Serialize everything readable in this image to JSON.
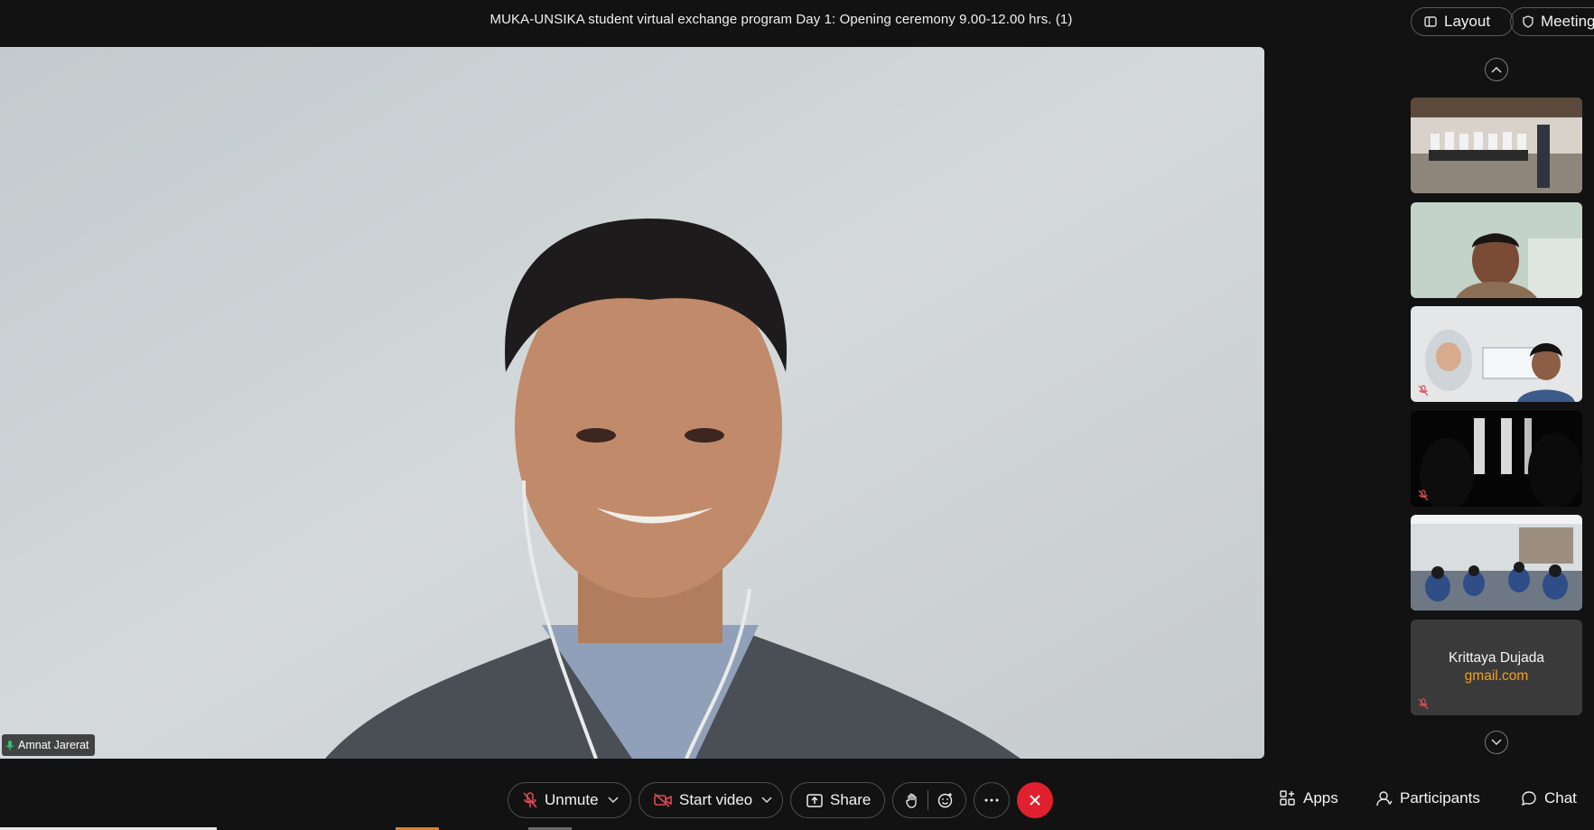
{
  "header": {
    "title": "MUKA-UNSIKA student virtual exchange program Day 1: Opening ceremony 9.00-12.00 hrs. (1)",
    "layout_label": "Layout",
    "meeting_label": "Meeting"
  },
  "main_video": {
    "speaker_name": "Amnat Jarerat"
  },
  "thumbnails": [
    {
      "kind": "video",
      "muted": false
    },
    {
      "kind": "video",
      "muted": false
    },
    {
      "kind": "video",
      "muted": true
    },
    {
      "kind": "video",
      "muted": true
    },
    {
      "kind": "video",
      "muted": false
    },
    {
      "kind": "name-card",
      "muted": true
    }
  ],
  "name_card": {
    "name": "Krittaya Dujada",
    "email": "gmail.com"
  },
  "toolbar": {
    "unmute_label": "Unmute",
    "start_video_label": "Start video",
    "share_label": "Share",
    "apps_label": "Apps",
    "participants_label": "Participants",
    "chat_label": "Chat"
  },
  "colors": {
    "background": "#121212",
    "end_call": "#e0202e",
    "email_accent": "#f2a11d",
    "muted_icon": "#e04a5a",
    "speaking_icon": "#2fbf71"
  }
}
